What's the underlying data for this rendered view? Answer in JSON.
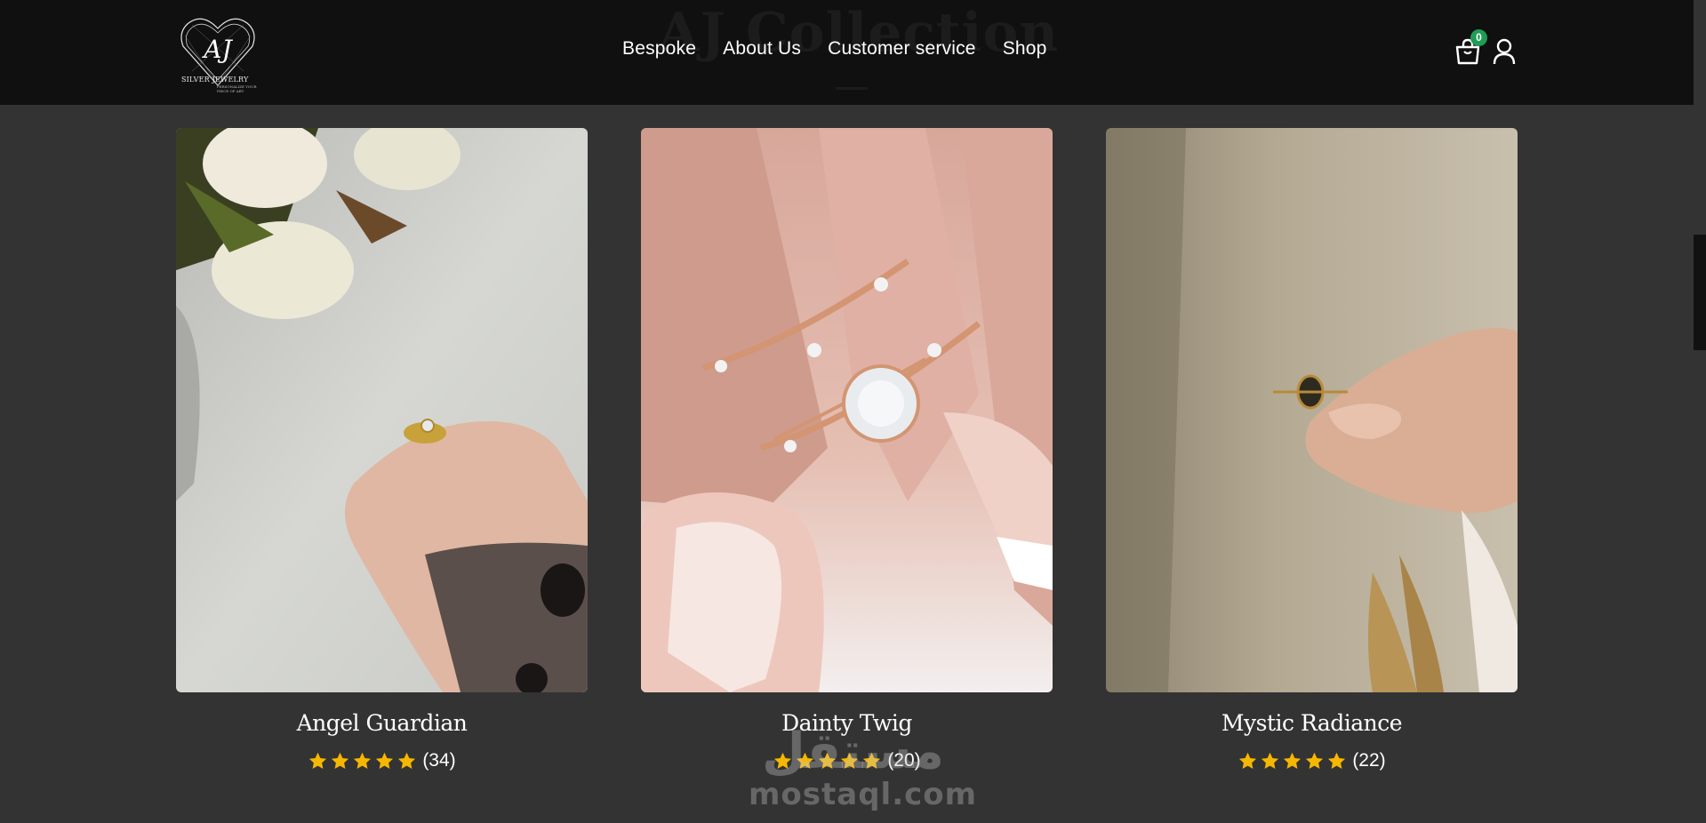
{
  "header": {
    "background_title": "AJ Collection",
    "logo": {
      "monogram": "AJ",
      "brand_line": "SILVER JEWELRY",
      "tagline": "PERSONALIZE YOUR PIECE OF ART"
    },
    "nav": [
      {
        "label": "Bespoke"
      },
      {
        "label": "About Us"
      },
      {
        "label": "Customer service"
      },
      {
        "label": "Shop"
      }
    ],
    "cart": {
      "count": "0",
      "icon": "shopping-bag-icon"
    },
    "account": {
      "icon": "user-icon"
    }
  },
  "products": [
    {
      "name": "Angel Guardian",
      "rating": 5,
      "reviews": "(34)",
      "image": "hand holding gold ring with flowers"
    },
    {
      "name": "Dainty Twig",
      "rating": 5,
      "reviews": "(20)",
      "image": "rose gold twig ring set on finger"
    },
    {
      "name": "Mystic Radiance",
      "rating": 5,
      "reviews": "(22)",
      "image": "hand holding dark stone ring"
    }
  ],
  "watermark": {
    "arabic": "مستقل",
    "latin": "mostaql.com"
  },
  "colors": {
    "header_bg": "#101010",
    "page_bg": "#333333",
    "star": "#f5b700",
    "badge": "#1f9d55"
  }
}
